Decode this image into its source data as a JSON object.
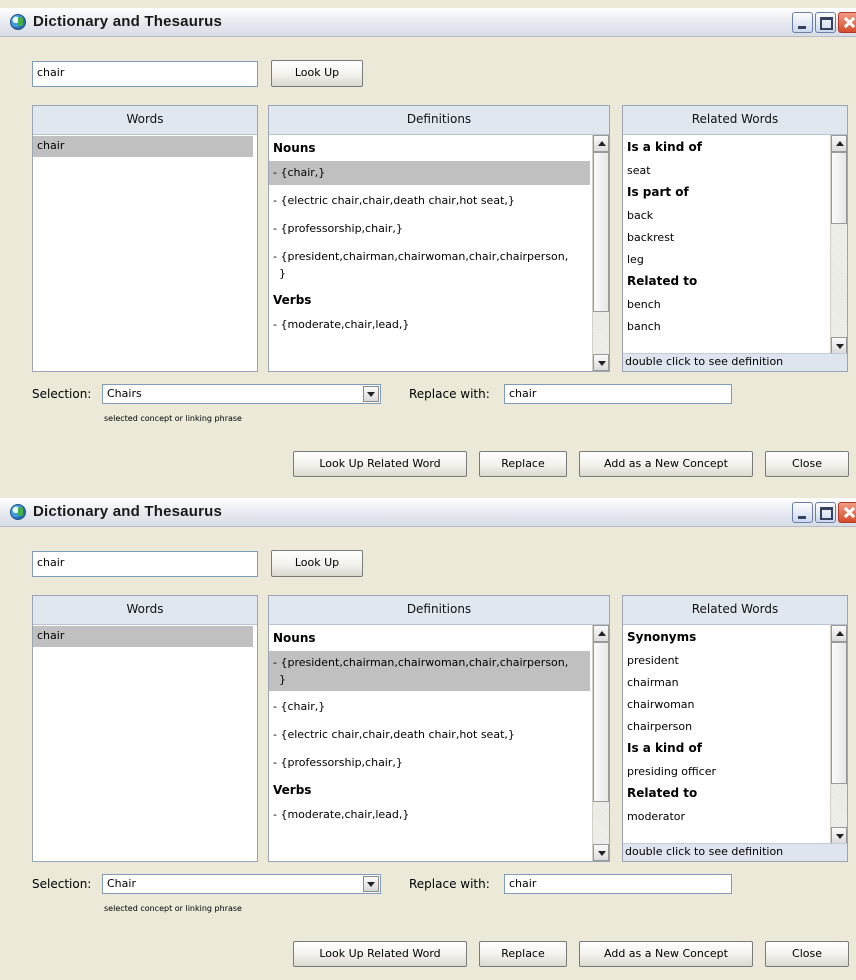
{
  "windows": [
    {
      "title": "Dictionary and Thesaurus",
      "search_value": "chair",
      "lookup_label": "Look Up",
      "words_header": "Words",
      "words": [
        "chair"
      ],
      "definitions_header": "Definitions",
      "definitions": [
        {
          "type": "header",
          "text": "Nouns"
        },
        {
          "type": "item",
          "text": "- {chair,}",
          "selected": true
        },
        {
          "type": "item",
          "text": "- {electric chair,chair,death chair,hot seat,}"
        },
        {
          "type": "item",
          "text": "- {professorship,chair,}"
        },
        {
          "type": "item",
          "text": "- {president,chairman,chairwoman,chair,chairperson,",
          "cont": "}"
        },
        {
          "type": "header",
          "text": "Verbs"
        },
        {
          "type": "item",
          "text": "- {moderate,chair,lead,}"
        }
      ],
      "related_header": "Related Words",
      "related": [
        {
          "type": "header",
          "text": "Is a kind of"
        },
        {
          "type": "item",
          "text": "seat"
        },
        {
          "type": "header",
          "text": "Is part of"
        },
        {
          "type": "item",
          "text": "back"
        },
        {
          "type": "item",
          "text": "backrest"
        },
        {
          "type": "item",
          "text": "leg"
        },
        {
          "type": "header",
          "text": "Related to"
        },
        {
          "type": "item",
          "text": "bench"
        },
        {
          "type": "item",
          "text": "banch"
        }
      ],
      "related_hint": "double click to see definition",
      "selection_label": "Selection:",
      "selection_value": "Chairs",
      "selection_hint": "selected concept or linking phrase",
      "replace_label": "Replace with:",
      "replace_value": "chair",
      "buttons": {
        "lookup_related": "Look Up Related Word",
        "replace": "Replace",
        "add_concept": "Add as a New Concept",
        "close": "Close"
      }
    },
    {
      "title": "Dictionary and Thesaurus",
      "search_value": "chair",
      "lookup_label": "Look Up",
      "words_header": "Words",
      "words": [
        "chair"
      ],
      "definitions_header": "Definitions",
      "definitions": [
        {
          "type": "header",
          "text": "Nouns"
        },
        {
          "type": "item",
          "text": "- {president,chairman,chairwoman,chair,chairperson,",
          "cont": "}",
          "selected": true
        },
        {
          "type": "item",
          "text": "- {chair,}"
        },
        {
          "type": "item",
          "text": "- {electric chair,chair,death chair,hot seat,}"
        },
        {
          "type": "item",
          "text": "- {professorship,chair,}"
        },
        {
          "type": "header",
          "text": "Verbs"
        },
        {
          "type": "item",
          "text": "- {moderate,chair,lead,}"
        }
      ],
      "related_header": "Related Words",
      "related": [
        {
          "type": "header",
          "text": "Synonyms"
        },
        {
          "type": "item",
          "text": "president"
        },
        {
          "type": "item",
          "text": "chairman"
        },
        {
          "type": "item",
          "text": "chairwoman"
        },
        {
          "type": "item",
          "text": "chairperson"
        },
        {
          "type": "header",
          "text": "Is a kind of"
        },
        {
          "type": "item",
          "text": "presiding officer"
        },
        {
          "type": "header",
          "text": "Related to"
        },
        {
          "type": "item",
          "text": "moderator"
        }
      ],
      "related_hint": "double click to see definition",
      "selection_label": "Selection:",
      "selection_value": "Chair",
      "selection_hint": "selected concept or linking phrase",
      "replace_label": "Replace with:",
      "replace_value": "chair",
      "buttons": {
        "lookup_related": "Look Up Related Word",
        "replace": "Replace",
        "add_concept": "Add as a New Concept",
        "close": "Close"
      }
    }
  ]
}
